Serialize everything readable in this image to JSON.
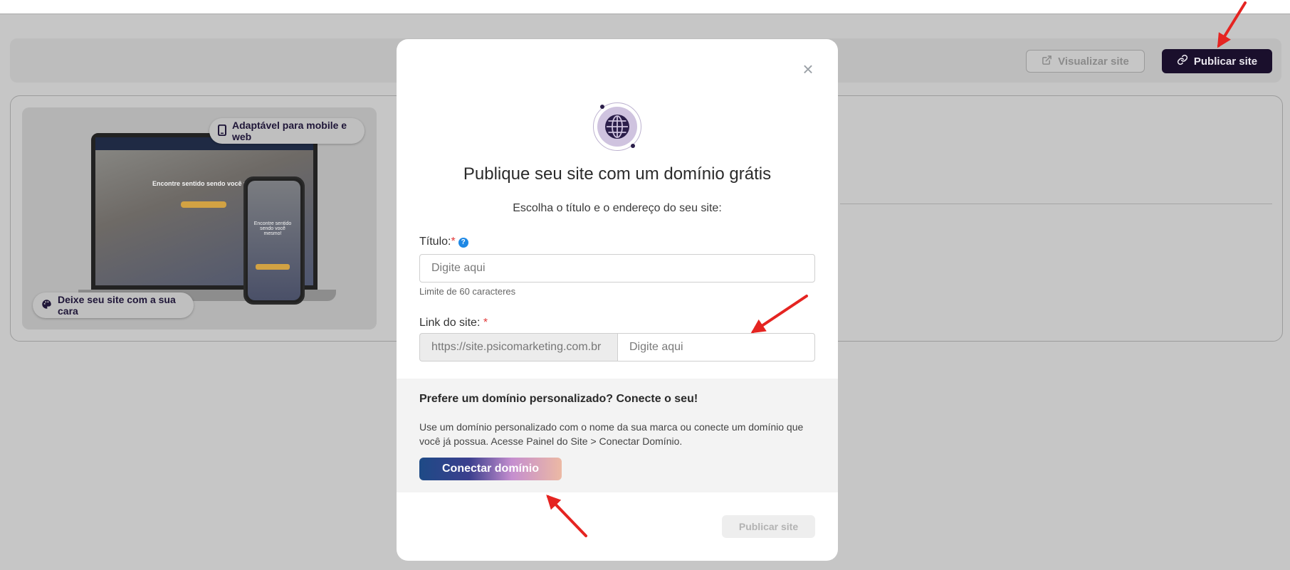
{
  "toolbar": {
    "view_site_label": "Visualizar site",
    "publish_site_label": "Publicar site"
  },
  "preview": {
    "badge_mobile": "Adaptável para mobile e web",
    "badge_custom": "Deixe seu site com a sua cara",
    "laptop_hero_text": "Encontre sentido sendo você mesmo",
    "phone_hero_text": "Encontre sentido sendo você mesmo!"
  },
  "modal": {
    "close_symbol": "×",
    "title": "Publique seu site com um domínio grátis",
    "subtitle": "Escolha o título e o endereço do seu site:",
    "title_field": {
      "label": "Título:",
      "required_mark": "*",
      "help_symbol": "?",
      "placeholder": "Digite aqui",
      "value": "",
      "hint": "Limite de 60 caracteres"
    },
    "link_field": {
      "label": "Link do site: ",
      "required_mark": "*",
      "prefix": "https://site.psicomarketing.com.br",
      "placeholder": "Digite aqui",
      "value": ""
    },
    "custom_domain": {
      "title": "Prefere um domínio personalizado? Conecte o seu!",
      "text": "Use um domínio personalizado com o nome da sua marca ou conecte um domínio que você já possua. Acesse Painel do Site > Conectar Domínio.",
      "button_label": "Conectar domínio"
    },
    "publish_button_label": "Publicar site"
  },
  "colors": {
    "overlay_gray": "#c6c6c6",
    "brand_dark": "#1a0f2c",
    "help_blue": "#1e88e5",
    "required_red": "#e23a3a",
    "arrow_red": "#e52421"
  },
  "icons": [
    "external-link-icon",
    "link-icon",
    "close-icon",
    "globe-icon",
    "help-icon",
    "smartphone-icon",
    "palette-icon"
  ]
}
